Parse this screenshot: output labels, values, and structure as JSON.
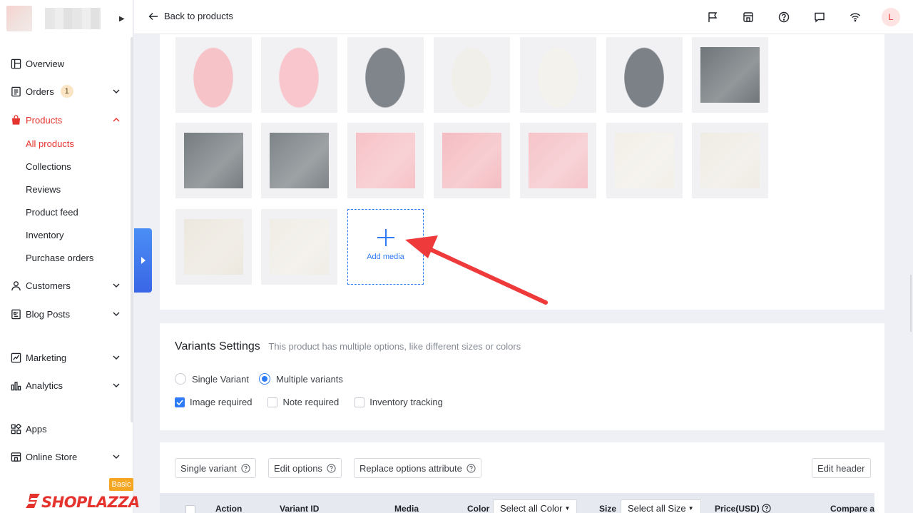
{
  "sidebar": {
    "nav": [
      {
        "id": "overview",
        "label": "Overview",
        "icon": "overview-icon"
      },
      {
        "id": "orders",
        "label": "Orders",
        "icon": "orders-icon",
        "badge": "1"
      },
      {
        "id": "products",
        "label": "Products",
        "icon": "products-icon",
        "active": true
      },
      {
        "id": "customers",
        "label": "Customers",
        "icon": "customers-icon"
      },
      {
        "id": "blog-posts",
        "label": "Blog Posts",
        "icon": "blog-icon"
      },
      {
        "id": "marketing",
        "label": "Marketing",
        "icon": "marketing-icon"
      },
      {
        "id": "analytics",
        "label": "Analytics",
        "icon": "analytics-icon"
      },
      {
        "id": "apps",
        "label": "Apps",
        "icon": "apps-icon"
      },
      {
        "id": "online-store",
        "label": "Online Store",
        "icon": "store-icon"
      }
    ],
    "products_sub": [
      "All products",
      "Collections",
      "Reviews",
      "Product feed",
      "Inventory",
      "Purchase orders"
    ],
    "brand": "SHOPLAZZA",
    "plan": "Basic"
  },
  "topbar": {
    "back_label": "Back to products",
    "avatar_initial": "L"
  },
  "media": {
    "add_label": "Add media",
    "thumbnails": [
      {
        "color": "#f6c3c8",
        "kind": "pink-vest"
      },
      {
        "color": "#f8c6cc",
        "kind": "pink-sack"
      },
      {
        "color": "#7f858b",
        "kind": "gray-vest"
      },
      {
        "color": "#f1efe9",
        "kind": "white-vest"
      },
      {
        "color": "#f4f2ec",
        "kind": "white-sack"
      },
      {
        "color": "#7b8187",
        "kind": "gray-sack"
      },
      {
        "color": "#6f7579",
        "kind": "gray-neck"
      },
      {
        "color": "#767c80",
        "kind": "gray-buttons"
      },
      {
        "color": "#7d8387",
        "kind": "gray-fold"
      },
      {
        "color": "#f6c2c7",
        "kind": "pink-buttons"
      },
      {
        "color": "#f4bdc2",
        "kind": "pink-fold"
      },
      {
        "color": "#f5c4c9",
        "kind": "pink-hem"
      },
      {
        "color": "#f2efe8",
        "kind": "white-neck"
      },
      {
        "color": "#efece4",
        "kind": "white-buttons"
      },
      {
        "color": "#ece8df",
        "kind": "white-knit"
      },
      {
        "color": "#f0ede6",
        "kind": "white-fold"
      }
    ]
  },
  "variants": {
    "title": "Variants Settings",
    "description": "This product has multiple options, like different sizes or colors",
    "single_label": "Single Variant",
    "multiple_label": "Multiple variants",
    "image_required": "Image required",
    "note_required": "Note required",
    "inventory_tracking": "Inventory tracking"
  },
  "table": {
    "buttons": {
      "single_variant": "Single variant",
      "edit_options": "Edit options",
      "replace_attr": "Replace options attribute",
      "edit_header": "Edit header"
    },
    "headers": {
      "action": "Action",
      "variant_id": "Variant ID",
      "media": "Media",
      "color": "Color",
      "color_select": "Select all Color",
      "size": "Size",
      "size_select": "Select all Size",
      "price": "Price(USD)",
      "compare": "Compare a"
    }
  }
}
